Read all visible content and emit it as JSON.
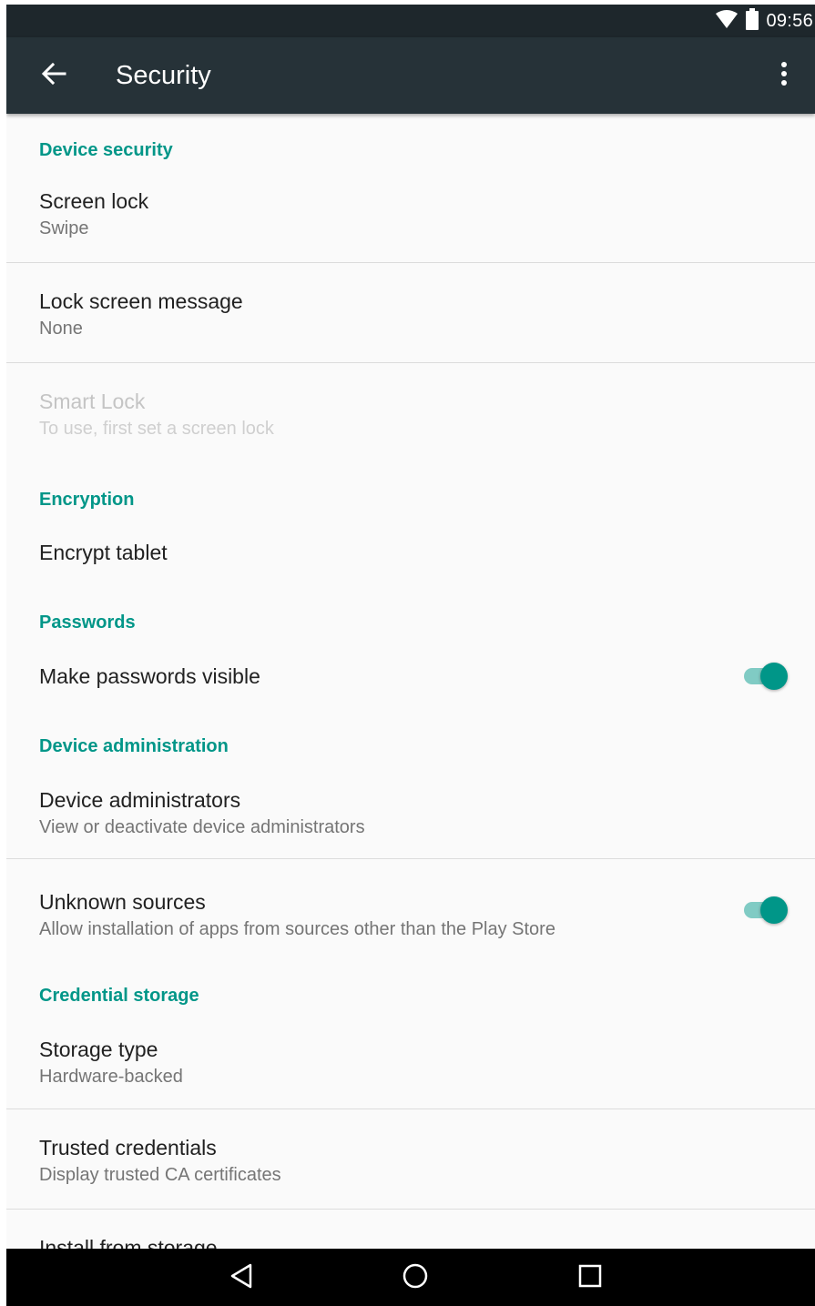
{
  "status_bar": {
    "time": "09:56",
    "icons": [
      "wifi-icon",
      "battery-icon"
    ]
  },
  "toolbar": {
    "title": "Security",
    "back_icon": "arrow-back-icon",
    "more_icon": "more-vert-icon"
  },
  "categories": {
    "device_security": "Device security",
    "encryption": "Encryption",
    "passwords": "Passwords",
    "device_administration": "Device administration",
    "credential_storage": "Credential storage"
  },
  "items": {
    "screen_lock": {
      "title": "Screen lock",
      "summary": "Swipe"
    },
    "lock_screen_message": {
      "title": "Lock screen message",
      "summary": "None"
    },
    "smart_lock": {
      "title": "Smart Lock",
      "summary": "To use, first set a screen lock",
      "enabled": false
    },
    "encrypt_tablet": {
      "title": "Encrypt tablet"
    },
    "make_passwords_visible": {
      "title": "Make passwords visible",
      "checked": true
    },
    "device_administrators": {
      "title": "Device administrators",
      "summary": "View or deactivate device administrators"
    },
    "unknown_sources": {
      "title": "Unknown sources",
      "summary": "Allow installation of apps from sources other than the Play Store",
      "checked": true
    },
    "storage_type": {
      "title": "Storage type",
      "summary": "Hardware-backed"
    },
    "trusted_credentials": {
      "title": "Trusted credentials",
      "summary": "Display trusted CA certificates"
    },
    "install_from_storage": {
      "title": "Install from storage"
    }
  },
  "nav_bar": {
    "buttons": [
      "back-triangle-icon",
      "home-circle-icon",
      "recents-square-icon"
    ]
  },
  "colors": {
    "accent": "#009688",
    "toolbar": "#263238",
    "status_bar": "#1e272c",
    "background": "#fafafa",
    "switch_track": "#80cbc4"
  }
}
